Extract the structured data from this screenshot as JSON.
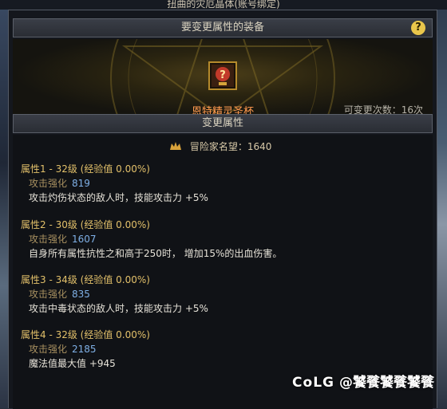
{
  "top_clip": "扭曲的灾厄晶体(账号绑定)",
  "header": {
    "title": "要变更属性的装备",
    "help_label": "?"
  },
  "item": {
    "name": "恩特精灵圣杯",
    "changes_left": "可变更次数：16次"
  },
  "section": {
    "title": "变更属性"
  },
  "fame": {
    "label": "冒险家名望：1640"
  },
  "attributes": [
    {
      "title": "属性1 - 32级 (经验值 0.00%)",
      "stat_label": "攻击强化",
      "stat_value": "819",
      "desc": "攻击灼伤状态的敌人时，技能攻击力 +5%"
    },
    {
      "title": "属性2 - 30级 (经验值 0.00%)",
      "stat_label": "攻击强化",
      "stat_value": "1607",
      "desc": "自身所有属性抗性之和高于250时， 增加15%的出血伤害。"
    },
    {
      "title": "属性3 - 34级 (经验值 0.00%)",
      "stat_label": "攻击强化",
      "stat_value": "835",
      "desc": "攻击中毒状态的敌人时，技能攻击力 +5%"
    },
    {
      "title": "属性4 - 32级 (经验值 0.00%)",
      "stat_label": "攻击强化",
      "stat_value": "2185",
      "desc": "魔法值最大值 +945"
    }
  ],
  "watermark": {
    "logo": "CoLG",
    "handle": "@饕餮饕餮饕餮"
  },
  "colors": {
    "gold": "#e2c06a",
    "orange_item": "#ff9a4f",
    "blue_value": "#7fb0e6"
  },
  "icons": [
    "help-icon",
    "chalice-item-icon",
    "fame-crown-icon"
  ]
}
